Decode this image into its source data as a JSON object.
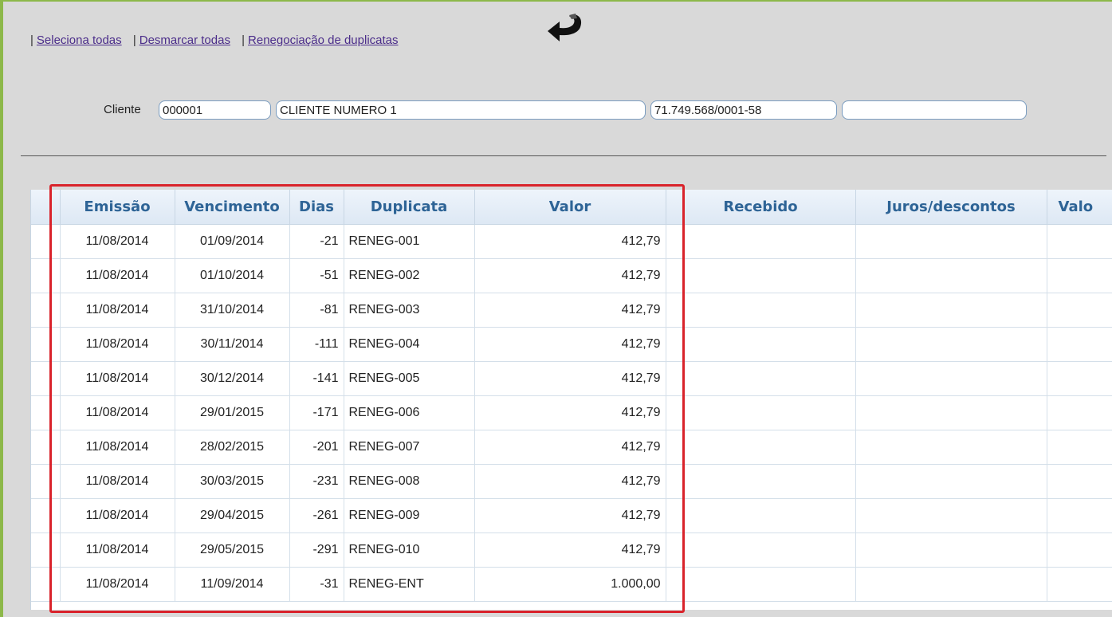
{
  "links": [
    "Seleciona todas",
    "Desmarcar todas",
    "Renegociação de duplicatas"
  ],
  "separator": "|",
  "icons": {
    "back": "curved-back-arrow-icon"
  },
  "cliente": {
    "label": "Cliente",
    "codigo": "000001",
    "nome": "CLIENTE NUMERO 1",
    "cnpj": "71.749.568/0001-58",
    "extra": ""
  },
  "table": {
    "headers": [
      "Emissão",
      "Vencimento",
      "Dias",
      "Duplicata",
      "Valor",
      "Recebido",
      "Juros/descontos",
      "Valo"
    ],
    "rows": [
      [
        "11/08/2014",
        "01/09/2014",
        "-21",
        "RENEG-001",
        "412,79",
        "",
        "",
        ""
      ],
      [
        "11/08/2014",
        "01/10/2014",
        "-51",
        "RENEG-002",
        "412,79",
        "",
        "",
        ""
      ],
      [
        "11/08/2014",
        "31/10/2014",
        "-81",
        "RENEG-003",
        "412,79",
        "",
        "",
        ""
      ],
      [
        "11/08/2014",
        "30/11/2014",
        "-111",
        "RENEG-004",
        "412,79",
        "",
        "",
        ""
      ],
      [
        "11/08/2014",
        "30/12/2014",
        "-141",
        "RENEG-005",
        "412,79",
        "",
        "",
        ""
      ],
      [
        "11/08/2014",
        "29/01/2015",
        "-171",
        "RENEG-006",
        "412,79",
        "",
        "",
        ""
      ],
      [
        "11/08/2014",
        "28/02/2015",
        "-201",
        "RENEG-007",
        "412,79",
        "",
        "",
        ""
      ],
      [
        "11/08/2014",
        "30/03/2015",
        "-231",
        "RENEG-008",
        "412,79",
        "",
        "",
        ""
      ],
      [
        "11/08/2014",
        "29/04/2015",
        "-261",
        "RENEG-009",
        "412,79",
        "",
        "",
        ""
      ],
      [
        "11/08/2014",
        "29/05/2015",
        "-291",
        "RENEG-010",
        "412,79",
        "",
        "",
        ""
      ],
      [
        "11/08/2014",
        "11/09/2014",
        "-31",
        "RENEG-ENT",
        "1.000,00",
        "",
        "",
        ""
      ]
    ]
  },
  "colors": {
    "accent_frame": "#8db84a",
    "header_text": "#2e6496",
    "highlight": "#d9232b",
    "link": "#4b2d8a"
  }
}
